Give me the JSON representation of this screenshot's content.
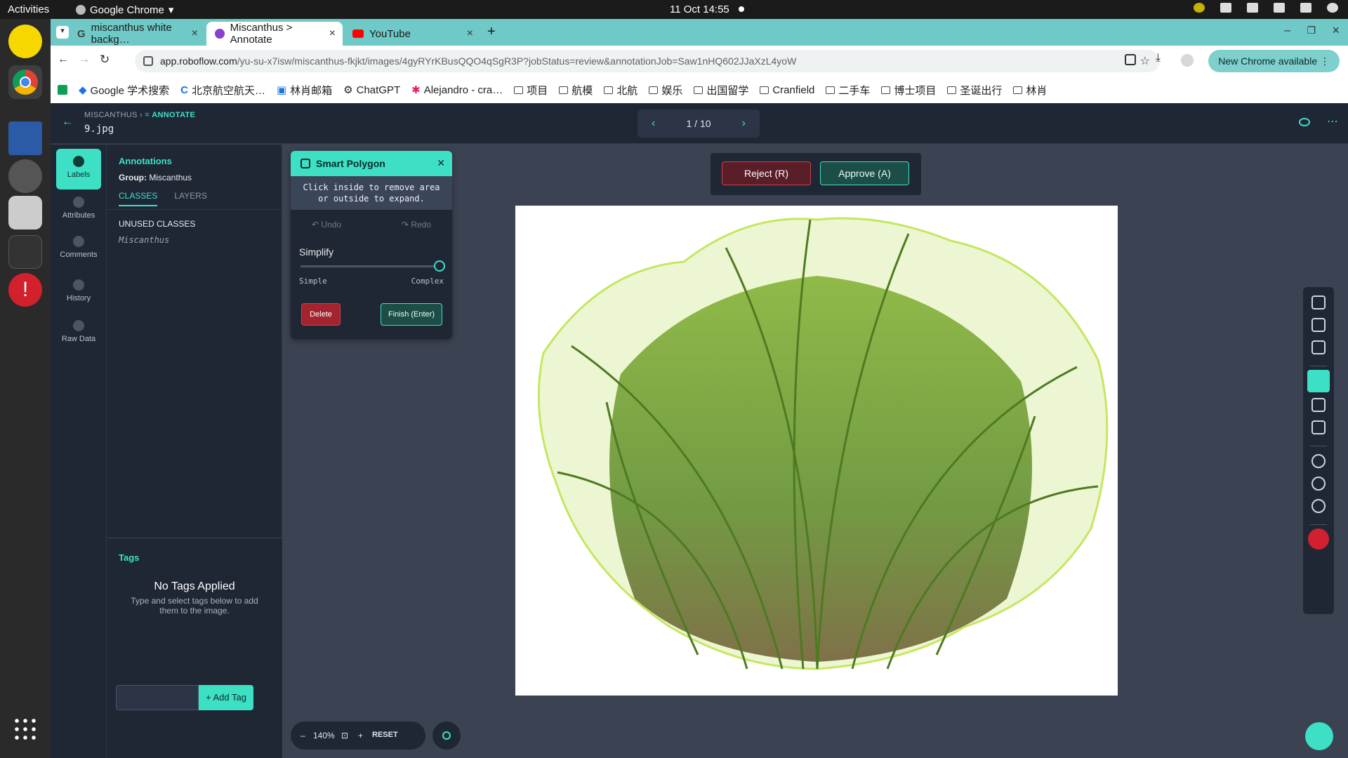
{
  "os": {
    "activities": "Activities",
    "app_name": "Google Chrome",
    "clock": "11 Oct  14:55"
  },
  "browser": {
    "tabs": [
      {
        "label": "miscanthus white backg…"
      },
      {
        "label": "Miscanthus > Annotate"
      },
      {
        "label": "YouTube"
      }
    ],
    "url_host": "app.roboflow.com",
    "url_path": "/yu-su-x7isw/miscanthus-fkjkt/images/4gyRYrKBusQQO4qSgR3P?jobStatus=review&annotationJob=Saw1nHQ602JJaXzL4yoW",
    "update_label": "New Chrome available",
    "bookmarks": [
      "Google 学术搜索",
      "北京航空航天…",
      "林肖邮箱",
      "ChatGPT",
      "Alejandro - cra…",
      "项目",
      "航模",
      "北航",
      "娱乐",
      "出国留学",
      "Cranfield",
      "二手车",
      "博士项目",
      "圣诞出行",
      "林肖"
    ]
  },
  "header": {
    "breadcrumb_project": "MISCANTHUS",
    "breadcrumb_current": "ANNOTATE",
    "filename": "9.jpg",
    "pager": "1 / 10"
  },
  "rail": [
    {
      "label": "Labels"
    },
    {
      "label": "Attributes"
    },
    {
      "label": "Comments"
    },
    {
      "label": "History"
    },
    {
      "label": "Raw Data"
    }
  ],
  "annotations": {
    "title": "Annotations",
    "group_label": "Group:",
    "group_value": "Miscanthus",
    "tab_classes": "CLASSES",
    "tab_layers": "LAYERS",
    "unused_title": "UNUSED CLASSES",
    "unused_class": "Miscanthus"
  },
  "tags": {
    "title": "Tags",
    "empty_title": "No Tags Applied",
    "empty_hint": "Type and select tags below to add them to the image.",
    "add_label": "+ Add Tag"
  },
  "smart_polygon": {
    "title": "Smart Polygon",
    "help": "Click inside to remove area or outside to expand.",
    "undo": "Undo",
    "redo": "Redo",
    "simplify": "Simplify",
    "min_label": "Simple",
    "max_label": "Complex",
    "delete": "Delete",
    "finish": "Finish (Enter)",
    "simplify_level": 1.0
  },
  "review": {
    "reject": "Reject (R)",
    "approve": "Approve (A)"
  },
  "zoom": {
    "level": "140%",
    "reset": "RESET"
  },
  "colors": {
    "accent": "#3ee0c5",
    "panel": "#1f2735",
    "reject": "#5a1e28",
    "tab_strip": "#6ec9c7"
  }
}
